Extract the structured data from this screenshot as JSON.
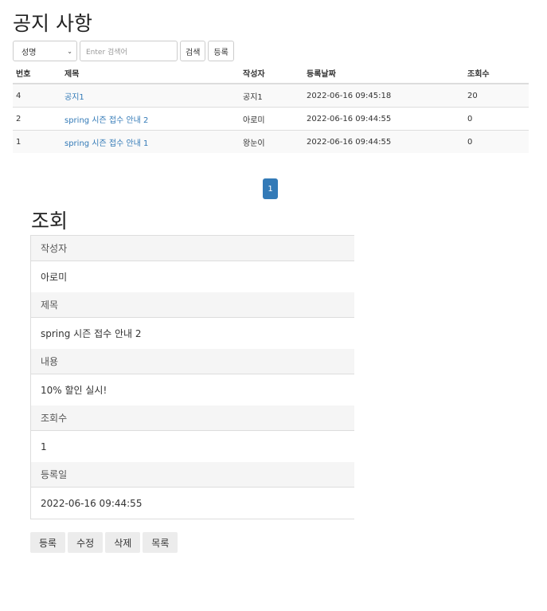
{
  "list": {
    "title": "공지 사항",
    "search": {
      "field_selected": "성명",
      "placeholder": "Enter 검색어",
      "search_label": "검색",
      "register_label": "등록"
    },
    "columns": [
      "번호",
      "제목",
      "작성자",
      "등록날짜",
      "조회수"
    ],
    "rows": [
      {
        "no": "4",
        "title": "공지1",
        "writer": "공지1",
        "date": "2022-06-16 09:45:18",
        "views": "20"
      },
      {
        "no": "2",
        "title": "spring 시즌 접수 안내 2",
        "writer": "아로미",
        "date": "2022-06-16 09:44:55",
        "views": "0"
      },
      {
        "no": "1",
        "title": "spring 시즌 접수 안내 1",
        "writer": "왕눈이",
        "date": "2022-06-16 09:44:55",
        "views": "0"
      }
    ],
    "pagination": {
      "current": "1"
    }
  },
  "detail": {
    "title": "조회",
    "fields": [
      {
        "label": "작성자",
        "value": "아로미"
      },
      {
        "label": "제목",
        "value": "spring 시즌 접수 안내 2"
      },
      {
        "label": "내용",
        "value": "10% 할인 실시!"
      },
      {
        "label": "조회수",
        "value": "1"
      },
      {
        "label": "등록일",
        "value": "2022-06-16 09:44:55"
      }
    ],
    "actions": [
      "등록",
      "수정",
      "삭제",
      "목록"
    ]
  },
  "colors": {
    "link": "#337ab7",
    "active_page": "#337ab7"
  },
  "icons": {
    "select": "chevron-down-icon"
  }
}
